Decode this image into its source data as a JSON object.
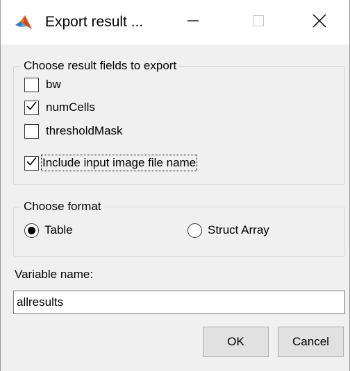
{
  "window": {
    "title": "Export result ...",
    "app_icon": "matlab-logo-icon",
    "controls": {
      "minimize": "minimize-icon",
      "maximize": "maximize-icon",
      "close": "close-icon"
    }
  },
  "fields_group": {
    "legend": "Choose result fields to export",
    "items": [
      {
        "label": "bw",
        "checked": false
      },
      {
        "label": "numCells",
        "checked": true
      },
      {
        "label": "thresholdMask",
        "checked": false
      }
    ],
    "include_filename": {
      "label": "Include input image file name",
      "checked": true,
      "focused": true
    }
  },
  "format_group": {
    "legend": "Choose format",
    "options": [
      {
        "label": "Table",
        "selected": true
      },
      {
        "label": "Struct Array",
        "selected": false
      }
    ]
  },
  "variable": {
    "label": "Variable name:",
    "value": "allresults"
  },
  "buttons": {
    "ok": "OK",
    "cancel": "Cancel"
  },
  "colors": {
    "dialog_bg": "#f0f0f0",
    "titlebar_bg": "#ffffff",
    "button_bg": "#e1e1e1",
    "group_border": "#d4d4d4"
  }
}
